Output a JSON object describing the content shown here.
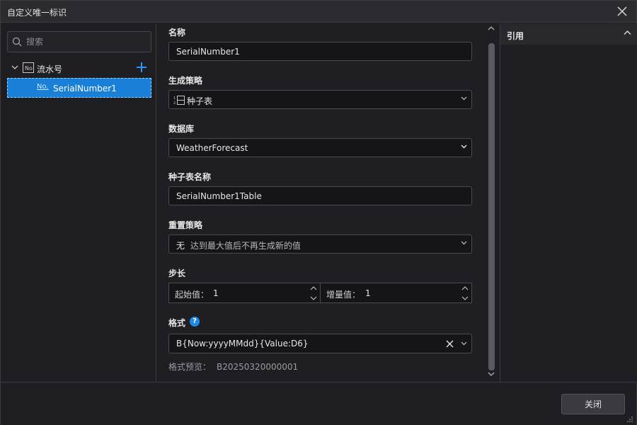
{
  "window": {
    "title": "自定义唯一标识"
  },
  "sidebar": {
    "search_placeholder": "搜索",
    "group_label": "流水号",
    "group_icon_text": "No",
    "item_icon_text": "No.",
    "item_label": "SerialNumber1"
  },
  "form": {
    "name": {
      "label": "名称",
      "value": "SerialNumber1"
    },
    "strategy": {
      "label": "生成策略",
      "value": "种子表"
    },
    "database": {
      "label": "数据库",
      "value": "WeatherForecast"
    },
    "seed_table": {
      "label": "种子表名称",
      "value": "SerialNumber1Table"
    },
    "reset": {
      "label": "重置策略",
      "value_main": "无",
      "value_desc": "达到最大值后不再生成新的值"
    },
    "step": {
      "label": "步长",
      "start_label": "起始值：",
      "start_value": "1",
      "inc_label": "增量值：",
      "inc_value": "1"
    },
    "format": {
      "label": "格式",
      "help": "?",
      "value": "B{Now:yyyyMMdd}{Value:D6}",
      "preview_label": "格式预览：",
      "preview_value": "B20250320000001"
    }
  },
  "right_panel": {
    "title": "引用"
  },
  "footer": {
    "close_label": "关闭"
  },
  "colors": {
    "accent": "#1a7fd6",
    "background": "#1f1f23"
  }
}
